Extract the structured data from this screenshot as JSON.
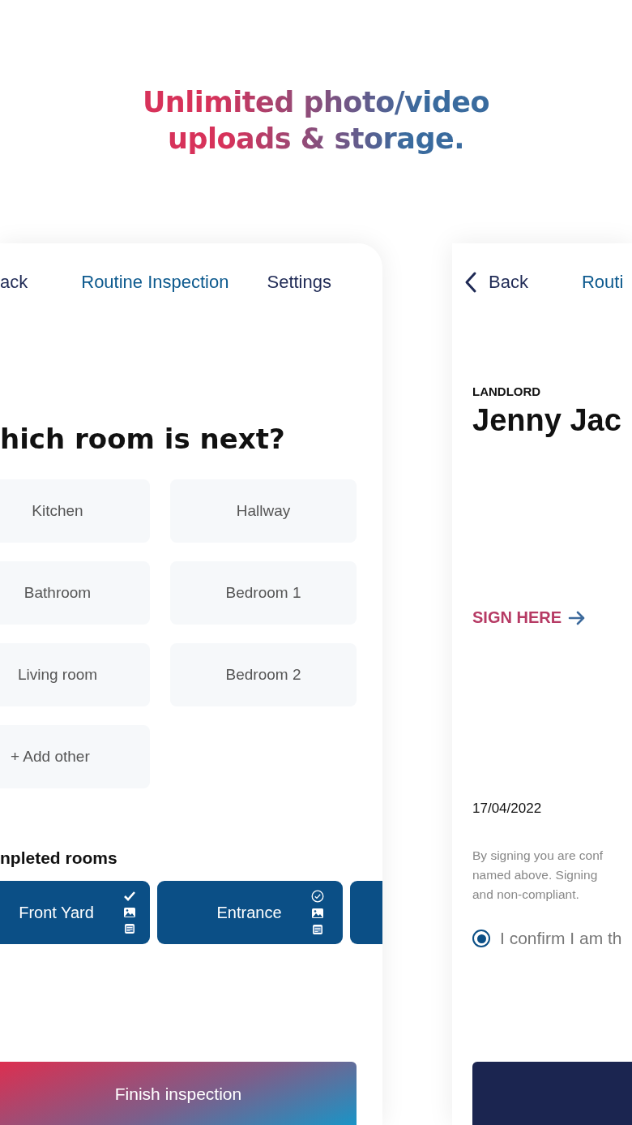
{
  "headline": {
    "lines": [
      "Unlimited photo/video",
      "uploads & storage."
    ]
  },
  "left_screen": {
    "nav": [
      {
        "label": "ack",
        "kind": "back"
      },
      {
        "label": "Routine Inspection",
        "kind": "title"
      },
      {
        "label": "Settings",
        "kind": "action"
      }
    ],
    "heading": "hich room is next?",
    "rooms": [
      {
        "label": "Kitchen",
        "kind": "room"
      },
      {
        "label": "Hallway",
        "kind": "room"
      },
      {
        "label": "Bathroom",
        "kind": "room"
      },
      {
        "label": "Bedroom 1",
        "kind": "room"
      },
      {
        "label": "Living room",
        "kind": "room"
      },
      {
        "label": "Bedroom 2",
        "kind": "room"
      },
      {
        "label": "+ Add other",
        "kind": "add"
      }
    ],
    "completed_heading": "npleted rooms",
    "completed_rooms": [
      {
        "label": "Front Yard",
        "kind": "check"
      },
      {
        "label": "Entrance",
        "kind": "check-circle"
      },
      {
        "kind": "partial"
      }
    ],
    "finish_button": "Finish inspection"
  },
  "right_screen": {
    "nav": [
      {
        "label": "Back",
        "kind": "back"
      },
      {
        "label": "Routi",
        "kind": "title"
      }
    ],
    "role": "LANDLORD",
    "name": "Jenny Jac",
    "sign_link": "SIGN HERE",
    "date": "17/04/2022",
    "notice": [
      "By signing you are conf",
      "named above. Signing",
      "and non-compliant."
    ],
    "confirm": {
      "label": "I confirm I am th",
      "selected": true
    }
  }
}
